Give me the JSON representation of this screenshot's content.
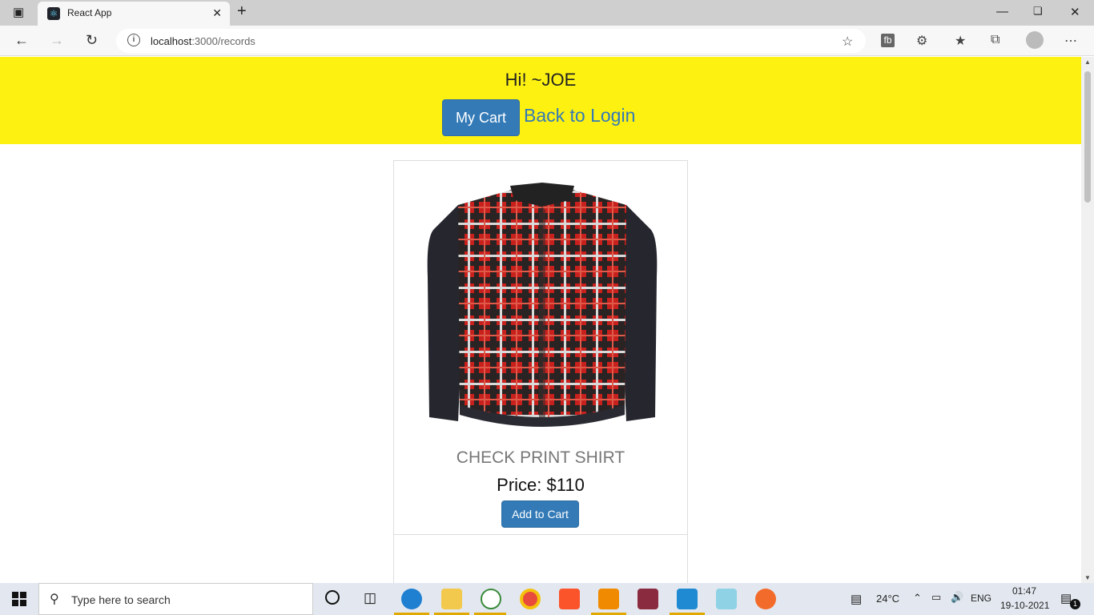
{
  "browser": {
    "tab_title": "React App",
    "url_host": "localhost",
    "url_path": ":3000/records"
  },
  "page": {
    "greeting": "Hi! ~JOE",
    "my_cart_label": "My Cart",
    "back_to_login_label": "Back to Login",
    "products": [
      {
        "name": "CHECK PRINT SHIRT",
        "price": "Price: $110",
        "add_to_cart_label": "Add to Cart"
      }
    ]
  },
  "taskbar": {
    "search_placeholder": "Type here to search",
    "weather": "24°C",
    "language": "ENG",
    "time": "01:47",
    "date": "19-10-2021",
    "notification_count": "1"
  },
  "colors": {
    "header_bg": "#fdf112",
    "primary_button": "#337ab7"
  }
}
